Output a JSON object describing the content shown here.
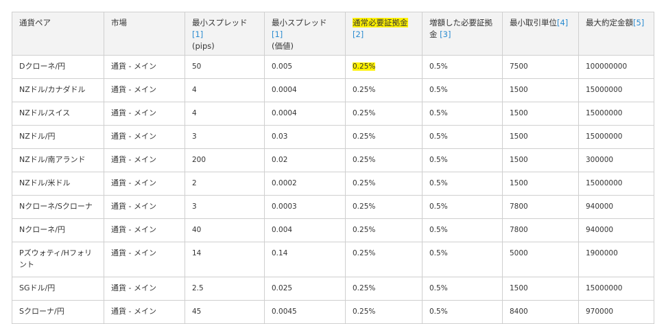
{
  "headers": [
    {
      "text": "通貨ペア",
      "note": ""
    },
    {
      "text": "市場",
      "note": ""
    },
    {
      "text": "最小スプレッド ",
      "note": "[1]",
      "sub": "(pips)"
    },
    {
      "text": "最小スプレッド ",
      "note": "[1]",
      "sub": "(価値)"
    },
    {
      "text": "通常必要証拠金",
      "note": "[2]",
      "highlight": true
    },
    {
      "text": "増額した必要証拠金 ",
      "note": "[3]"
    },
    {
      "text": "最小取引単位",
      "note": "[4]"
    },
    {
      "text": "最大約定金額",
      "note": "[5]"
    }
  ],
  "rows": [
    {
      "pair": "Dクローネ/円",
      "market": "通貨 - メイン",
      "spread_pips": "50",
      "spread_value": "0.005",
      "margin": "0.25%",
      "margin_highlight": true,
      "increased_margin": "0.5%",
      "min_unit": "7500",
      "max_amount": "100000000"
    },
    {
      "pair": "NZドル/カナダドル",
      "market": "通貨 - メイン",
      "spread_pips": "4",
      "spread_value": "0.0004",
      "margin": "0.25%",
      "increased_margin": "0.5%",
      "min_unit": "1500",
      "max_amount": "15000000"
    },
    {
      "pair": "NZドル/スイス",
      "market": "通貨 - メイン",
      "spread_pips": "4",
      "spread_value": "0.0004",
      "margin": "0.25%",
      "increased_margin": "0.5%",
      "min_unit": "1500",
      "max_amount": "15000000"
    },
    {
      "pair": "NZドル/円",
      "market": "通貨 - メイン",
      "spread_pips": "3",
      "spread_value": "0.03",
      "margin": "0.25%",
      "increased_margin": "0.5%",
      "min_unit": "1500",
      "max_amount": "15000000"
    },
    {
      "pair": "NZドル/南アランド",
      "market": "通貨 - メイン",
      "spread_pips": "200",
      "spread_value": "0.02",
      "margin": "0.25%",
      "increased_margin": "0.5%",
      "min_unit": "1500",
      "max_amount": "300000"
    },
    {
      "pair": "NZドル/米ドル",
      "market": "通貨 - メイン",
      "spread_pips": "2",
      "spread_value": "0.0002",
      "margin": "0.25%",
      "increased_margin": "0.5%",
      "min_unit": "1500",
      "max_amount": "15000000"
    },
    {
      "pair": "Nクローネ/Sクローナ",
      "market": "通貨 - メイン",
      "spread_pips": "3",
      "spread_value": "0.0003",
      "margin": "0.25%",
      "increased_margin": "0.5%",
      "min_unit": "7800",
      "max_amount": "940000"
    },
    {
      "pair": "Nクローネ/円",
      "market": "通貨 - メイン",
      "spread_pips": "40",
      "spread_value": "0.004",
      "margin": "0.25%",
      "increased_margin": "0.5%",
      "min_unit": "7800",
      "max_amount": "940000"
    },
    {
      "pair": "Pズウォティ/Hフォリント",
      "market": "通貨 - メイン",
      "spread_pips": "14",
      "spread_value": "0.14",
      "margin": "0.25%",
      "increased_margin": "0.5%",
      "min_unit": "5000",
      "max_amount": "1900000",
      "tall": true
    },
    {
      "pair": "SGドル/円",
      "market": "通貨 - メイン",
      "spread_pips": "2.5",
      "spread_value": "0.025",
      "margin": "0.25%",
      "increased_margin": "0.5%",
      "min_unit": "1500",
      "max_amount": "15000000"
    },
    {
      "pair": "Sクローナ/円",
      "market": "通貨 - メイン",
      "spread_pips": "45",
      "spread_value": "0.0045",
      "margin": "0.25%",
      "increased_margin": "0.5%",
      "min_unit": "8400",
      "max_amount": "970000"
    }
  ],
  "colors": {
    "highlight": "#fff200",
    "footnote_link": "#2a8bd0",
    "header_bg": "#f3f3f3",
    "border": "#cfcfcf"
  }
}
